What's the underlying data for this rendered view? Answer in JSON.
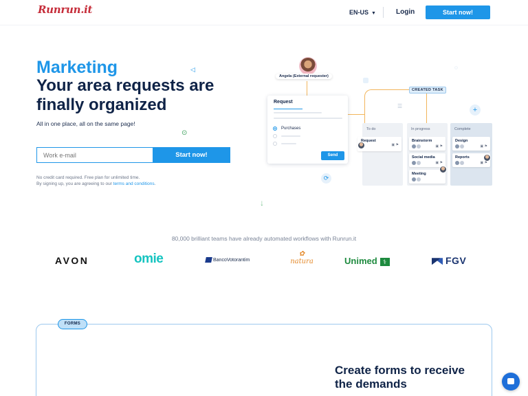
{
  "header": {
    "logo": "Runrun.it",
    "language": "EN-US",
    "login": "Login",
    "cta": "Start now!"
  },
  "hero": {
    "kicker": "Marketing",
    "title": "Your area requests are finally organized",
    "subtitle": "All in one place, all on the same page!",
    "email_placeholder": "Work e-mail",
    "cta": "Start now!",
    "note_line1": "No credit card required. Free plan for unlimited time.",
    "note_line2_prefix": "By signing up, you are agreeing to our ",
    "note_link": "terms and conditions",
    "note_line2_suffix": "."
  },
  "illustration": {
    "requester": "Angela (External requester)",
    "created_tag": "CREATED TASK",
    "request_card": {
      "title": "Request",
      "option": "Purchases",
      "send": "Send"
    },
    "columns": [
      {
        "title": "To do",
        "tasks": [
          "Request"
        ]
      },
      {
        "title": "In progress",
        "tasks": [
          "Brainstorm",
          "Social media",
          "Meeting"
        ]
      },
      {
        "title": "Complete",
        "tasks": [
          "Design",
          "Reports"
        ]
      }
    ]
  },
  "proof": {
    "text": "80,000 brilliant teams have already automated workflows with Runrun.it",
    "logos": [
      "AVON",
      "omie",
      "BancoVotorantim",
      "natura",
      "Unimed",
      "FGV"
    ]
  },
  "forms": {
    "tag": "FORMS",
    "title": "Create forms to receive the demands"
  },
  "colors": {
    "accent": "#1e96e8",
    "navy": "#0f2347",
    "brand_red": "#c62d3a"
  }
}
